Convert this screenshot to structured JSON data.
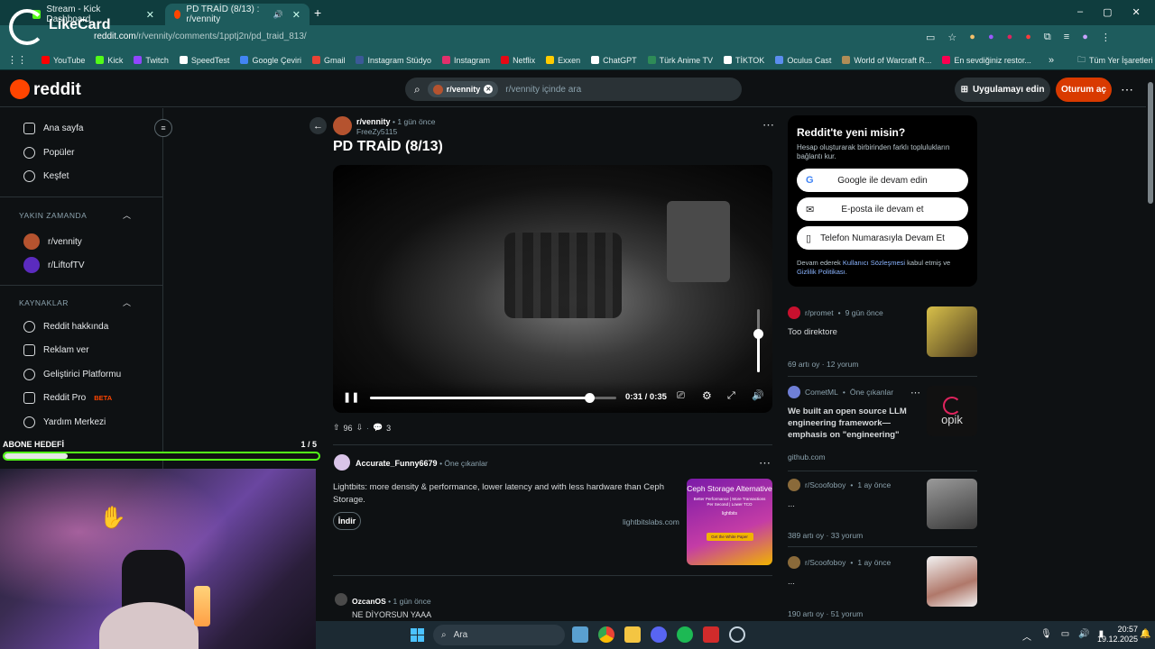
{
  "browser": {
    "tabs": [
      {
        "title": "Stream - Kick Dashboard"
      },
      {
        "title": "PD TRAİD (8/13) : r/vennity"
      }
    ],
    "url_host": "reddit.com",
    "url_path": "/r/vennity/comments/1pptj2n/pd_traid_813/",
    "overlay_logo": "LikeCard",
    "bookmarks": [
      {
        "label": "YouTube",
        "color": "#ff0000"
      },
      {
        "label": "Kick",
        "color": "#53fc18"
      },
      {
        "label": "Twitch",
        "color": "#9146ff"
      },
      {
        "label": "SpeedTest",
        "color": "#ffffff"
      },
      {
        "label": "Google Çeviri",
        "color": "#4285f4"
      },
      {
        "label": "Gmail",
        "color": "#ea4335"
      },
      {
        "label": "Instagram Stüdyo",
        "color": "#3b5998"
      },
      {
        "label": "Instagram",
        "color": "#e1306c"
      },
      {
        "label": "Netflix",
        "color": "#e50914"
      },
      {
        "label": "Exxen",
        "color": "#ffcc00"
      },
      {
        "label": "ChatGPT",
        "color": "#ffffff"
      },
      {
        "label": "Türk Anime TV",
        "color": "#2e8b57"
      },
      {
        "label": "TİKTOK",
        "color": "#ffffff"
      },
      {
        "label": "Oculus Cast",
        "color": "#5b8def"
      },
      {
        "label": "World of Warcraft R...",
        "color": "#b08d57"
      },
      {
        "label": "En sevdiğiniz restor...",
        "color": "#fa0050"
      }
    ],
    "all_bookmarks": "Tüm Yer İşaretleri"
  },
  "reddit": {
    "logo": "reddit",
    "search_chip": "r/vennity",
    "search_placeholder": "r/vennity içinde ara",
    "get_app": "Uygulamayı edin",
    "login": "Oturum aç"
  },
  "sidebar": {
    "main": [
      "Ana sayfa",
      "Popüler",
      "Keşfet"
    ],
    "recent_header": "YAKIN ZAMANDA",
    "recent": [
      {
        "label": "r/vennity",
        "color": "#b5532f"
      },
      {
        "label": "r/LiftofTV",
        "color": "#5b2bbf"
      }
    ],
    "resources_header": "KAYNAKLAR",
    "resources": [
      "Reddit hakkında",
      "Reklam ver",
      "Geliştirici Platformu",
      "Reddit Pro",
      "Yardım Merkezi"
    ],
    "beta": "BETA"
  },
  "post": {
    "subreddit": "r/vennity",
    "time": "1 gün önce",
    "author": "FreeZy5115",
    "title": "PD TRAİD (8/13)",
    "video_time": "0:31 / 0:35",
    "progress": 0.89,
    "volume": 0.6,
    "votes": "96",
    "comments": "3"
  },
  "ad": {
    "user": "Accurate_Funny6679",
    "tag": "Öne çıkanlar",
    "text": "Lightbits: more density & performance, lower latency and with less hardware than Ceph Storage.",
    "button": "İndir",
    "domain": "lightbitslabs.com",
    "img_title": "Ceph Storage Alternative",
    "img_sub": "Better Performance | More Transactions Per Second | Lower TCO",
    "img_brand": "lightbits",
    "img_cta": "Get the White Paper"
  },
  "comment": {
    "user": "OzcanOS",
    "time": "1 gün önce",
    "text": "NE DİYORSUN YAAA"
  },
  "signup": {
    "title": "Reddit'te yeni misin?",
    "subtitle": "Hesap oluşturarak birbirinden farklı toplulukların bağlantı kur.",
    "google": "Google ile devam edin",
    "email": "E-posta ile devam et",
    "phone": "Telefon Numarasıyla Devam Et",
    "terms_prefix": "Devam ederek",
    "terms_link": "Kullanıcı Sözleşmesi",
    "terms_mid": "kabul etmiş ve",
    "privacy_link": "Gizlilik Politikası",
    "terms_suffix": "."
  },
  "recent_posts": [
    {
      "sub": "r/promet",
      "time": "9 gün önce",
      "title": "Too direktore",
      "upvotes": "69 artı oy",
      "comments": "12 yorum",
      "av": "#c8102e",
      "thumb": "#b89a2a"
    },
    {
      "sub": "CometML",
      "time": "Öne çıkanlar",
      "title": "We built an open source LLM engineering framework—emphasis on \"engineering\"",
      "link": "github.com",
      "av": "#6f7fd6",
      "thumb": "#1a1a1a",
      "thumb_text": "opik"
    },
    {
      "sub": "r/Scoofoboy",
      "time": "1 ay önce",
      "title": "...",
      "upvotes": "389 artı oy",
      "comments": "33 yorum",
      "av": "#8a6a3a",
      "thumb": "#5a5a5a"
    },
    {
      "sub": "r/Scoofoboy",
      "time": "1 ay önce",
      "title": "...",
      "upvotes": "190 artı oy",
      "comments": "51 yorum",
      "av": "#8a6a3a",
      "thumb": "#7a4a3a"
    }
  ],
  "stream_overlay": {
    "label": "ABONE HEDEFİ",
    "count": "1 / 5",
    "progress": 0.2
  },
  "taskbar": {
    "search": "Ara",
    "time": "20:57",
    "date": "19.12.2025"
  }
}
